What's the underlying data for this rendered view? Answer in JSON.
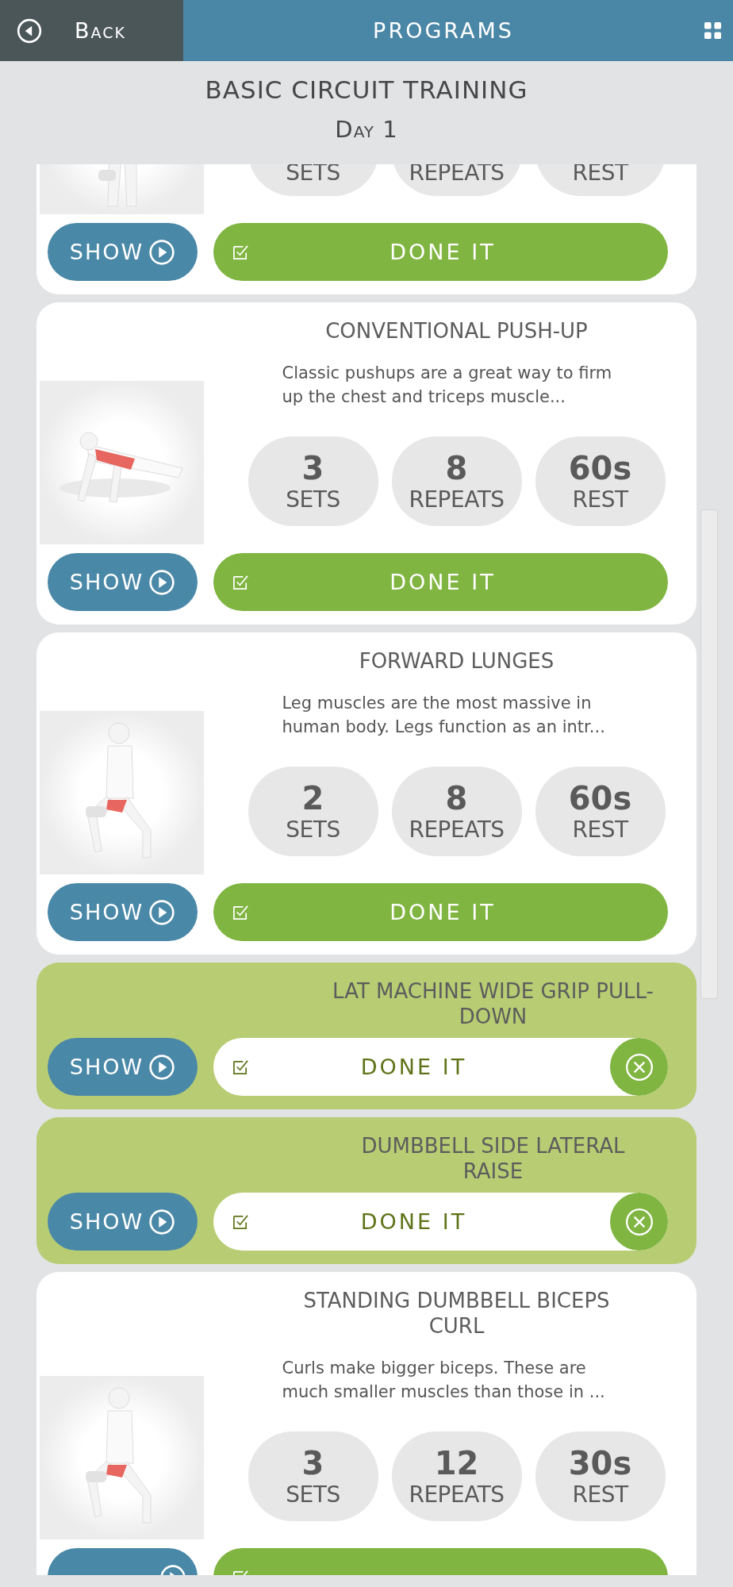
{
  "header": {
    "back_label": "Back",
    "title": "PROGRAMS"
  },
  "program": {
    "title": "BASIC CIRCUIT TRAINING",
    "day": "Day 1"
  },
  "exercises": [
    {
      "kind": "partial",
      "done": false,
      "stats": [
        {
          "label": "SETS"
        },
        {
          "label": "REPEATS"
        },
        {
          "label": "REST"
        }
      ],
      "show_label": "SHOW",
      "done_label": "DONE IT"
    },
    {
      "kind": "full",
      "done": false,
      "title": "CONVENTIONAL PUSH-UP",
      "description": "Classic pushups are a great way to firm up the chest and triceps muscle...",
      "stats": [
        {
          "value": "3",
          "label": "SETS"
        },
        {
          "value": "8",
          "label": "REPEATS"
        },
        {
          "value": "60s",
          "label": "REST"
        }
      ],
      "show_label": "SHOW",
      "done_label": "DONE IT"
    },
    {
      "kind": "full",
      "done": false,
      "title": "FORWARD LUNGES",
      "description": "Leg muscles are the most massive in human body. Legs function as an intr...",
      "stats": [
        {
          "value": "2",
          "label": "SETS"
        },
        {
          "value": "8",
          "label": "REPEATS"
        },
        {
          "value": "60s",
          "label": "REST"
        }
      ],
      "show_label": "SHOW",
      "done_label": "DONE IT"
    },
    {
      "kind": "full",
      "done": true,
      "title": "LAT MACHINE WIDE GRIP PULL-DOWN",
      "show_label": "SHOW",
      "done_label": "DONE IT"
    },
    {
      "kind": "full",
      "done": true,
      "title": "DUMBBELL SIDE LATERAL RAISE",
      "show_label": "SHOW",
      "done_label": "DONE IT"
    },
    {
      "kind": "full",
      "done": false,
      "title": "STANDING DUMBBELL BICEPS CURL",
      "description": "Curls make bigger biceps. These are much smaller muscles than those in ...",
      "stats": [
        {
          "value": "3",
          "label": "SETS"
        },
        {
          "value": "12",
          "label": "REPEATS"
        },
        {
          "value": "30s",
          "label": "REST"
        }
      ]
    }
  ]
}
